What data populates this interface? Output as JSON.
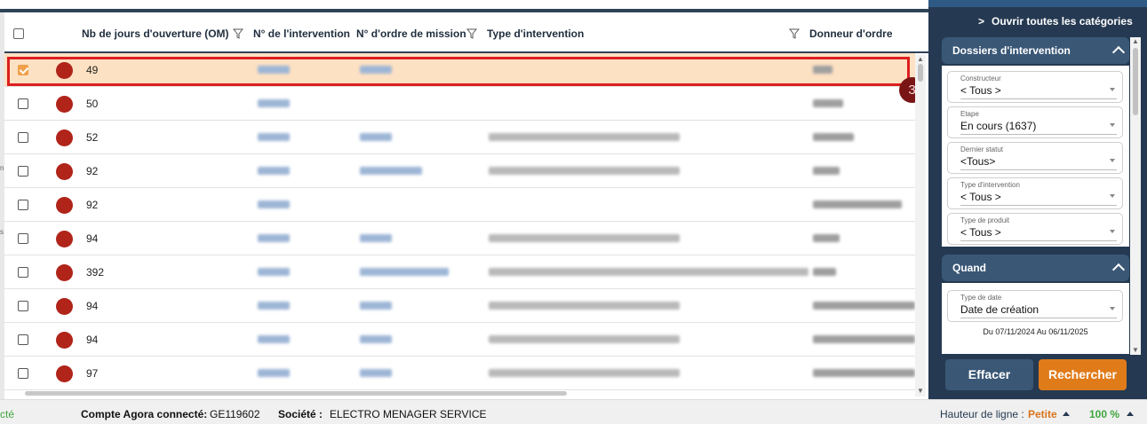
{
  "table": {
    "columns": [
      {
        "label": "Nb de jours d'ouverture (OM)",
        "filter": true
      },
      {
        "label": "N° de l'intervention",
        "filter": false
      },
      {
        "label": "N° d'ordre de mission",
        "filter": true
      },
      {
        "label": "Type d'intervention",
        "filter": true
      },
      {
        "label": "Donneur d'ordre",
        "filter": false
      }
    ],
    "rows": [
      {
        "days": "49",
        "selected": true
      },
      {
        "days": "50",
        "selected": false
      },
      {
        "days": "52",
        "selected": false
      },
      {
        "days": "92",
        "selected": false
      },
      {
        "days": "92",
        "selected": false
      },
      {
        "days": "94",
        "selected": false
      },
      {
        "days": "392",
        "selected": false
      },
      {
        "days": "94",
        "selected": false
      },
      {
        "days": "94",
        "selected": false
      },
      {
        "days": "97",
        "selected": false
      }
    ],
    "status_dot_color": "#b0241a",
    "highlight_badge": "3"
  },
  "sidebar": {
    "open_all": "Ouvrir toutes les catégories",
    "sections": [
      {
        "title": "Dossiers d'intervention",
        "fields": [
          {
            "label": "Constructeur",
            "value": "< Tous >"
          },
          {
            "label": "Etape",
            "value": "En cours (1637)"
          },
          {
            "label": "Dernier statut",
            "value": "<Tous>"
          },
          {
            "label": "Type d'intervention",
            "value": "< Tous >"
          },
          {
            "label": "Type de produit",
            "value": "< Tous >"
          }
        ]
      },
      {
        "title": "Quand",
        "fields": [
          {
            "label": "Type de date",
            "value": "Date de création"
          }
        ],
        "date_range": "Du 07/11/2024 Au 06/11/2025"
      }
    ],
    "clear_label": "Effacer",
    "search_label": "Rechercher"
  },
  "status_bar": {
    "connection": "cté",
    "account_label": "Compte Agora connecté:",
    "account_value": "GE119602",
    "company_label": "Société :",
    "company_value": "ELECTRO MENAGER SERVICE",
    "line_height_label": "Hauteur de ligne :",
    "line_height_value": "Petite",
    "zoom": "100 %"
  },
  "colors": {
    "accent_orange": "#e07b1a",
    "sidebar_bg": "#253a52",
    "selected_row": "#fde1c3",
    "highlight_border": "#dd1e1e"
  }
}
